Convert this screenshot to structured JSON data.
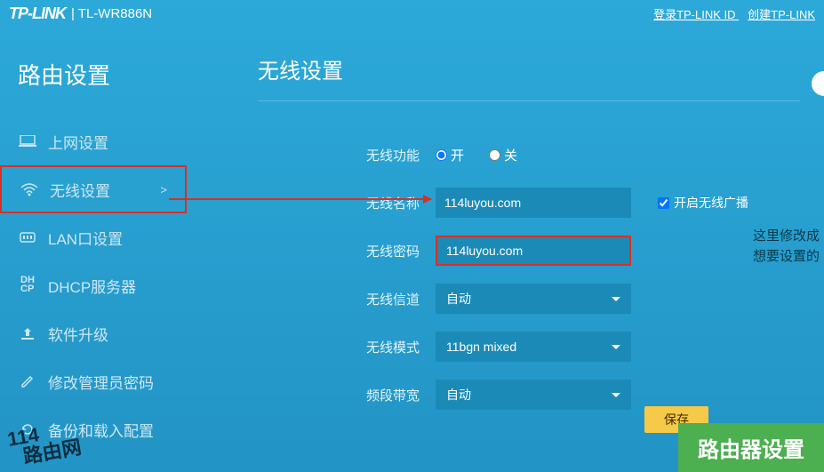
{
  "top": {
    "logo": "TP-LINK",
    "model": "| TL-WR886N",
    "login_link": "登录TP-LINK ID",
    "create_link": "创建TP-LINK"
  },
  "sidebar": {
    "title": "路由设置",
    "items": [
      {
        "id": "internet",
        "label": "上网设置",
        "icon": "laptop"
      },
      {
        "id": "wireless",
        "label": "无线设置",
        "icon": "wifi",
        "active": true,
        "arrow": ">"
      },
      {
        "id": "lan",
        "label": "LAN口设置",
        "icon": "lan"
      },
      {
        "id": "dhcp",
        "label": "DHCP服务器",
        "icon": "dhcp"
      },
      {
        "id": "upgrade",
        "label": "软件升级",
        "icon": "upload"
      },
      {
        "id": "admin",
        "label": "修改管理员密码",
        "icon": "pencil"
      },
      {
        "id": "backup",
        "label": "备份和载入配置",
        "icon": "refresh"
      }
    ]
  },
  "content": {
    "title": "无线设置",
    "rows": {
      "enable": {
        "label": "无线功能",
        "on": "开",
        "off": "关",
        "value": "on"
      },
      "ssid": {
        "label": "无线名称",
        "value": "114luyou.com",
        "broadcast": "开启无线广播",
        "broadcast_checked": true
      },
      "password": {
        "label": "无线密码",
        "value": "114luyou.com"
      },
      "channel": {
        "label": "无线信道",
        "value": "自动"
      },
      "mode": {
        "label": "无线模式",
        "value": "11bgn mixed"
      },
      "bandwidth": {
        "label": "频段带宽",
        "value": "自动"
      }
    },
    "save": "保存"
  },
  "annotations": {
    "note_line1": "这里修改成",
    "note_line2": "想要设置的",
    "watermark": [
      "114",
      "路由网"
    ],
    "green_banner": "路由器设置"
  }
}
